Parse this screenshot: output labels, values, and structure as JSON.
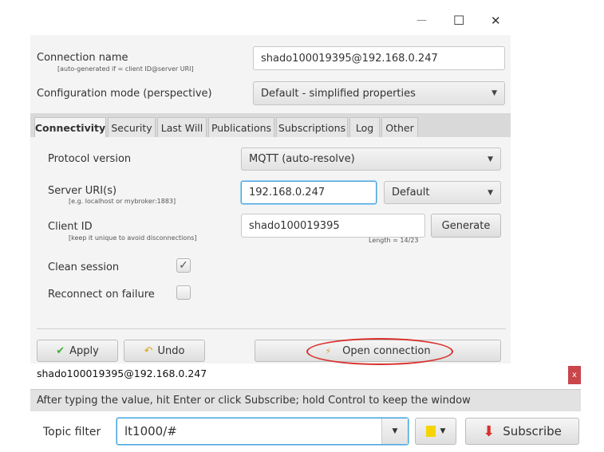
{
  "window": {
    "minimize": "—",
    "maximize": "☐",
    "close": "✕"
  },
  "connection_name": {
    "label": "Connection name",
    "hint": "[auto-generated if = client ID@server URI]",
    "value": "shado100019395@192.168.0.247"
  },
  "config_mode": {
    "label": "Configuration mode (perspective)",
    "value": "Default - simplified properties"
  },
  "tabs": [
    "Connectivity",
    "Security",
    "Last Will",
    "Publications",
    "Subscriptions",
    "Log",
    "Other"
  ],
  "protocol": {
    "label": "Protocol version",
    "value": "MQTT (auto-resolve)"
  },
  "server": {
    "label": "Server URI(s)",
    "hint": "[e.g. localhost or mybroker:1883]",
    "value": "192.168.0.247",
    "port_mode": "Default"
  },
  "client_id": {
    "label": "Client ID",
    "hint": "[keep it unique to avoid disconnections]",
    "value": "shado100019395",
    "generate": "Generate",
    "length": "Length = 14/23"
  },
  "clean_session": {
    "label": "Clean session",
    "checked": true
  },
  "reconnect": {
    "label": "Reconnect on failure",
    "checked": false
  },
  "buttons": {
    "apply": "Apply",
    "undo": "Undo",
    "open": "Open connection"
  },
  "connection_tab": {
    "title": "shado100019395@192.168.0.247",
    "close": "x"
  },
  "hint": "After typing the value, hit Enter or click Subscribe; hold Control to keep the window",
  "topic": {
    "label": "Topic filter",
    "value": "lt1000/#",
    "subscribe": "Subscribe",
    "color": "#f5d400"
  },
  "accent": "#d9302c"
}
